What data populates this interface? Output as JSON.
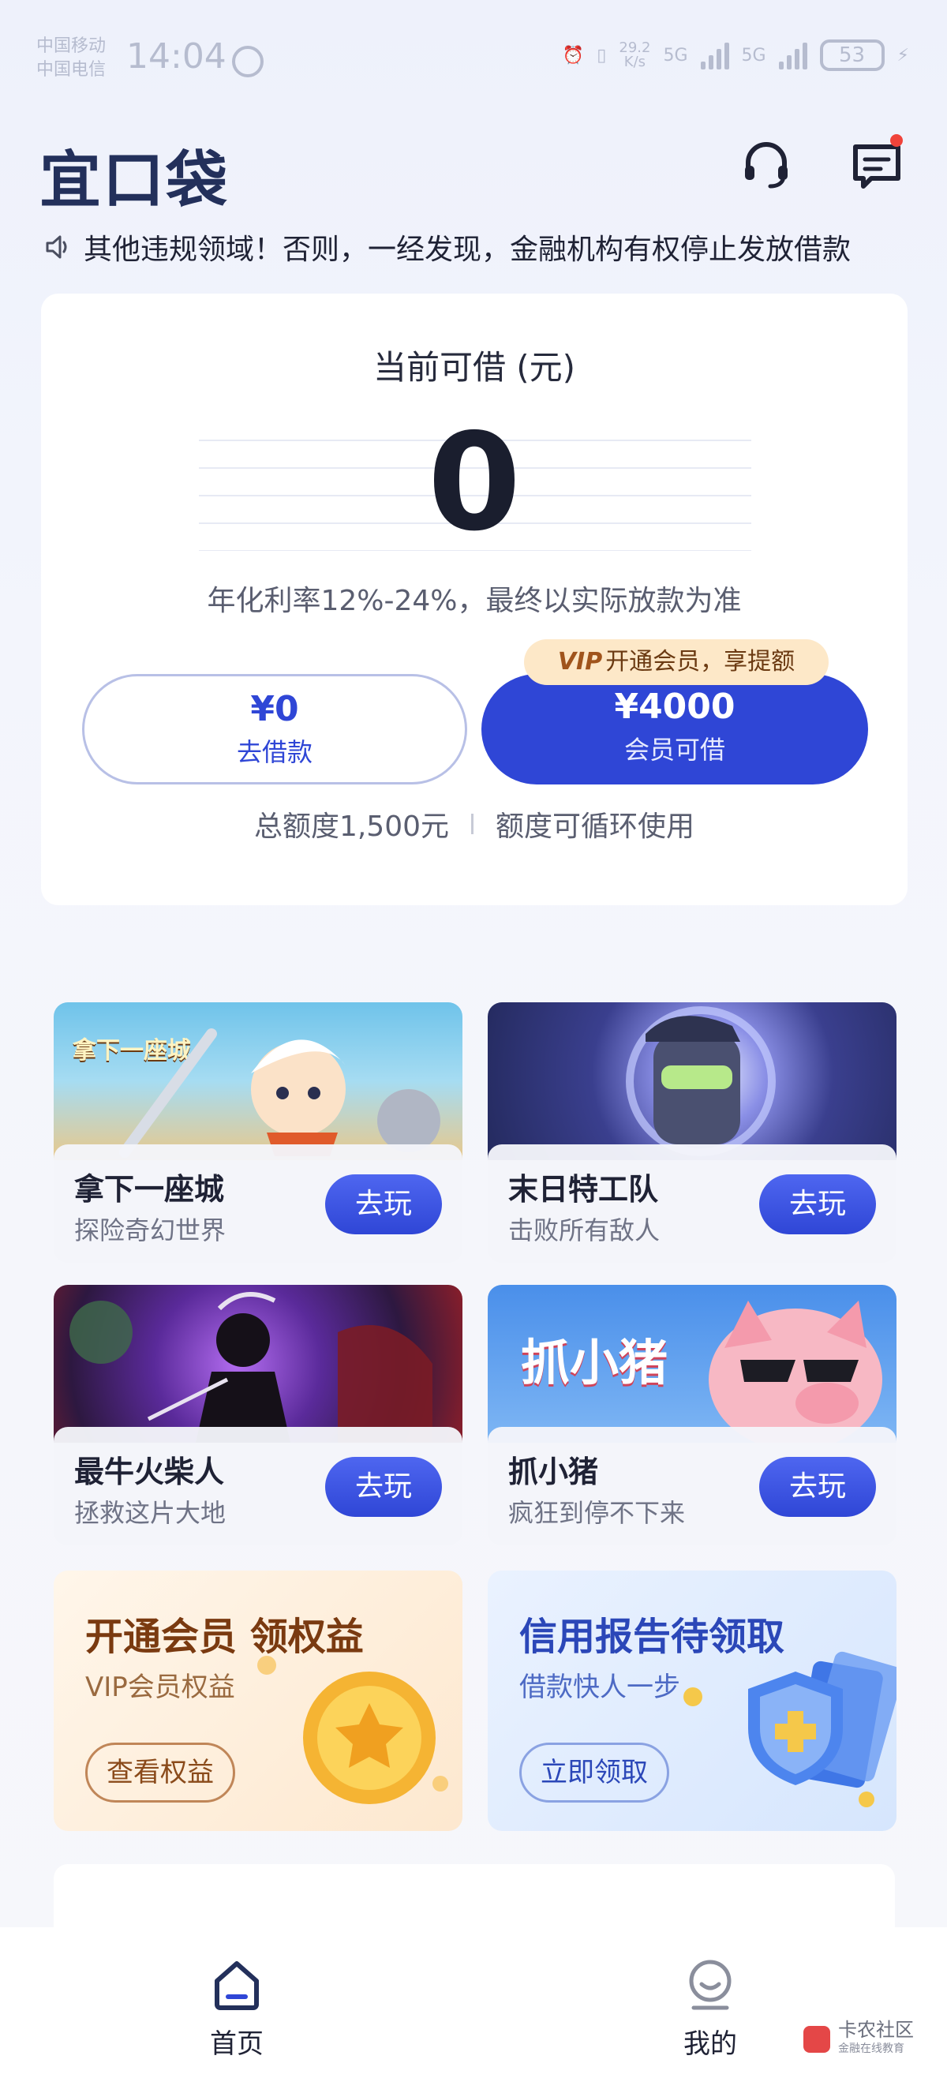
{
  "status_bar": {
    "carrier_1": "中国移动",
    "carrier_2": "中国电信",
    "time": "14:04",
    "network_speed_value": "29.2",
    "network_speed_unit": "K/s",
    "net_1": "5G",
    "net_2": "5G",
    "battery": "53"
  },
  "header": {
    "app_name": "宜口袋",
    "icons": [
      "headset-icon",
      "message-icon"
    ]
  },
  "notice": {
    "text": "其他违规领域！否则，一经发现，金融机构有权停止发放借款"
  },
  "credit_card": {
    "title": "当前可借 (元)",
    "amount": "0",
    "rate_note": "年化利率12%-24%，最终以实际放款为准",
    "borrow_button": {
      "amount": "¥0",
      "label": "去借款"
    },
    "vip_button": {
      "amount": "¥4000",
      "label": "会员可借"
    },
    "vip_tag": {
      "logo": "VIP",
      "text": "开通会员，享提额"
    },
    "total_limit": "总额度1,500元",
    "recycle_note": "额度可循环使用"
  },
  "games": [
    {
      "name": "拿下一座城",
      "desc": "探险奇幻世界",
      "art_title": "拿下一座城",
      "button": "去玩"
    },
    {
      "name": "末日特工队",
      "desc": "击败所有敌人",
      "button": "去玩"
    },
    {
      "name": "最牛火柴人",
      "desc": "拯救这片大地",
      "button": "去玩"
    },
    {
      "name": "抓小猪",
      "desc": "疯狂到停不下来",
      "art_title": "抓小猪",
      "button": "去玩"
    }
  ],
  "promos": [
    {
      "title": "开通会员 领权益",
      "subtitle": "VIP会员权益",
      "button": "查看权益"
    },
    {
      "title": "信用报告待领取",
      "subtitle": "借款快人一步",
      "button": "立即领取"
    }
  ],
  "tabbar": {
    "home": "首页",
    "mine": "我的"
  },
  "watermark": {
    "title": "卡农社区",
    "subtitle": "金融在线教育"
  },
  "colors": {
    "accent": "#2f46d6",
    "vip_tag_bg": "#fde8c8",
    "background": "#f3f5fc"
  }
}
